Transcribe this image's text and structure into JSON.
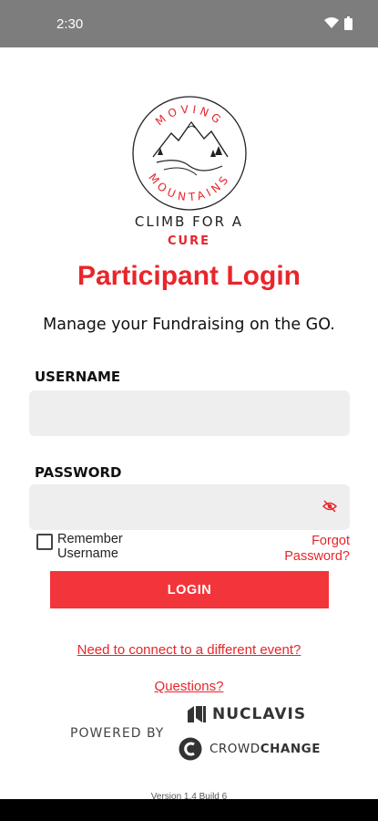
{
  "status_bar": {
    "time": "2:30",
    "icons": [
      "wifi-icon",
      "battery-icon"
    ]
  },
  "logo": {
    "top_text": "MOVING",
    "bottom_text": "MOUNTAINS",
    "tagline": "CLIMB FOR A",
    "cure": "CURE"
  },
  "title": "Participant Login",
  "subtitle": "Manage your Fundraising on the GO.",
  "form": {
    "username_label": "USERNAME",
    "username_value": "",
    "password_label": "PASSWORD",
    "password_value": "",
    "remember_label": "Remember Username",
    "remember_checked": false,
    "forgot_link": "Forgot Password?",
    "login_button": "LOGIN"
  },
  "links": {
    "different_event": "Need to connect to a different event?",
    "questions": "Questions?"
  },
  "footer": {
    "powered_by": "POWERED BY",
    "nuclavis": "NUCLAVIS",
    "crowdchange_light": "CROWD",
    "crowdchange_bold": "CHANGE",
    "version": "Version 1.4 Build 6"
  },
  "colors": {
    "accent": "#e8252b",
    "button": "#f2353b",
    "field_bg": "#eeeeee",
    "status_bar": "#7d7d7d"
  }
}
